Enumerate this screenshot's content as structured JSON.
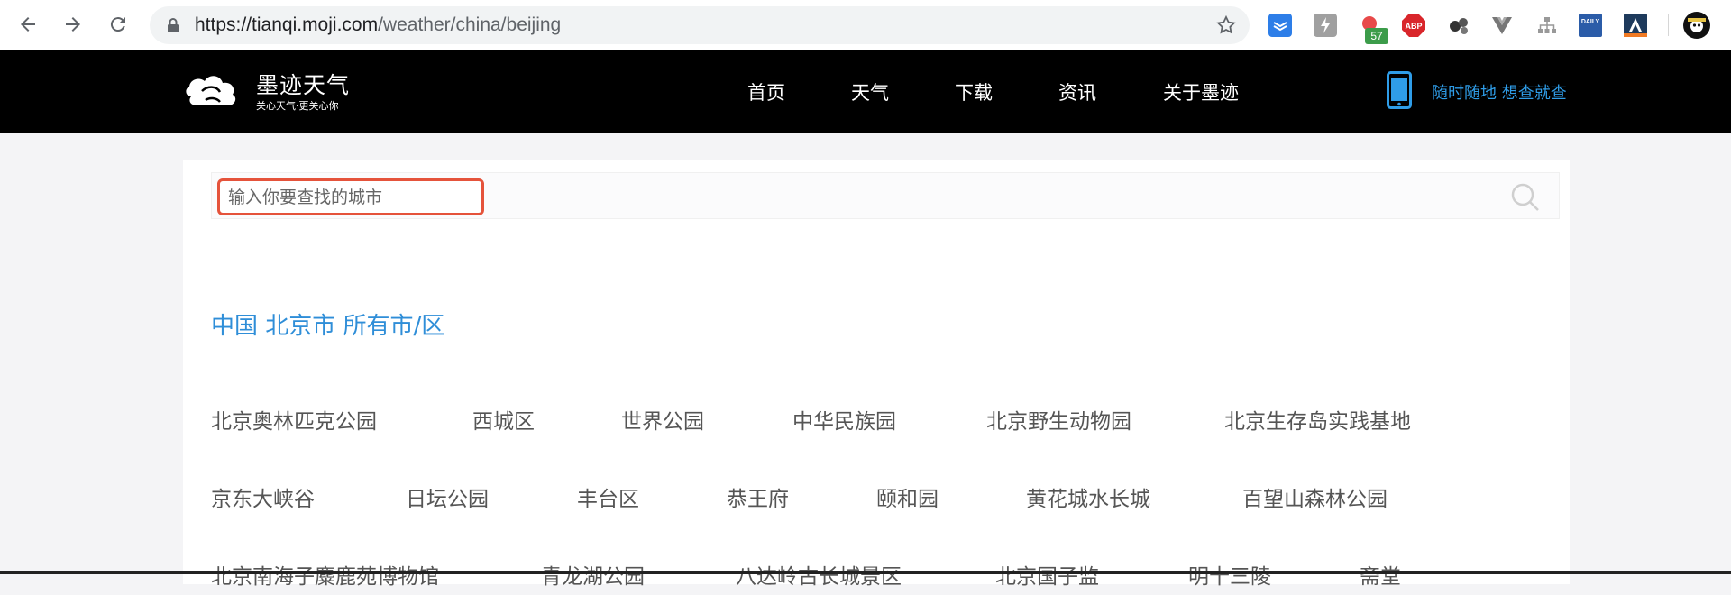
{
  "browser": {
    "url_host": "https://tianqi.moji.com",
    "url_path": "/weather/china/beijing",
    "extension_badge": "57",
    "extensions": [
      "todoist-icon",
      "shortcut-icon",
      "notification-icon",
      "adblock-plus-icon",
      "molecule-icon",
      "vue-devtools-icon",
      "sitemap-icon",
      "daily-dev-icon",
      "profile-icon",
      "pirate-avatar-icon"
    ],
    "adblock_label": "ABP",
    "daily_label": "DAILY"
  },
  "site": {
    "logo_title": "墨迹天气",
    "logo_slogan": "关心天气·更关心你",
    "nav": [
      "首页",
      "天气",
      "下载",
      "资讯",
      "关于墨迹"
    ],
    "app_promo": "随时随地 想查就查"
  },
  "search": {
    "placeholder": "输入你要查找的城市"
  },
  "region_title": "中国 北京市 所有市/区",
  "cities": {
    "row1": [
      "北京奥林匹克公园",
      "西城区",
      "世界公园",
      "中华民族园",
      "北京野生动物园",
      "北京生存岛实践基地"
    ],
    "row2": [
      "京东大峡谷",
      "日坛公园",
      "丰台区",
      "恭王府",
      "颐和园",
      "黄花城水长城",
      "百望山森林公园"
    ],
    "row3": [
      "北京南海子麋鹿苑博物馆",
      "青龙湖公园",
      "八达岭古长城景区",
      "北京国子监",
      "明十三陵",
      "斋堂"
    ]
  },
  "colors": {
    "accent": "#2f8ed8",
    "header_bg": "#000000",
    "search_highlight": "#e5533b",
    "app_promo": "#2f9de8"
  }
}
